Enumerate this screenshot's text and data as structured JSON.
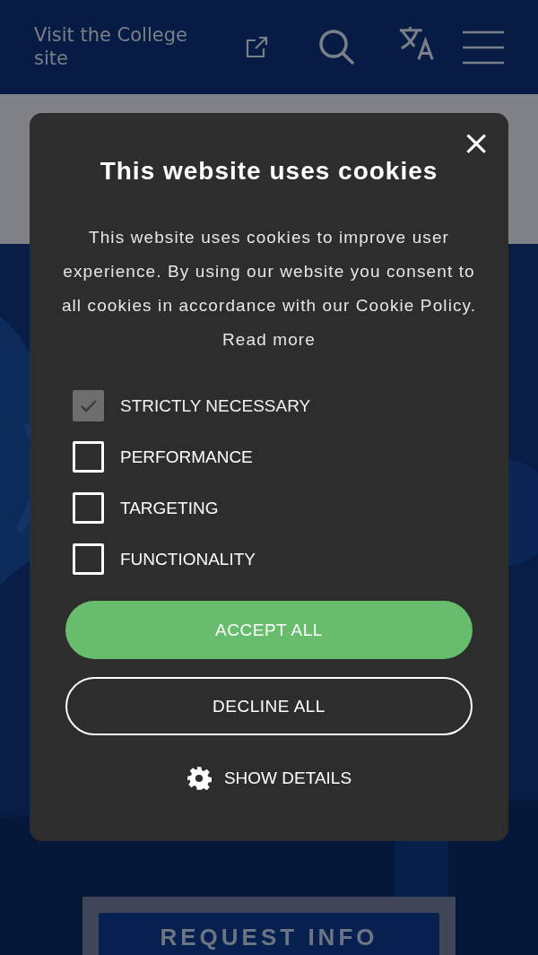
{
  "header": {
    "link": "Visit the College site"
  },
  "hero": {
    "kind": "picture",
    "button": "REQUEST INFO"
  },
  "cookie_dialog": {
    "close": "×",
    "title": "This website uses cookies",
    "message": "This website uses cookies to improve user experience. By using our website you consent to all cookies in accordance with our Cookie Policy.",
    "read_more": "Read more",
    "options": [
      {
        "label": "STRICTLY NECESSARY",
        "checked": true,
        "disabled": true
      },
      {
        "label": "PERFORMANCE",
        "checked": false,
        "disabled": false
      },
      {
        "label": "TARGETING",
        "checked": false,
        "disabled": false
      },
      {
        "label": "FUNCTIONALITY",
        "checked": false,
        "disabled": false
      }
    ],
    "buttons": [
      {
        "label": "ACCEPT ALL",
        "kind": "primary"
      },
      {
        "label": "DECLINE ALL",
        "kind": "outline"
      }
    ],
    "details": "SHOW DETAILS"
  }
}
